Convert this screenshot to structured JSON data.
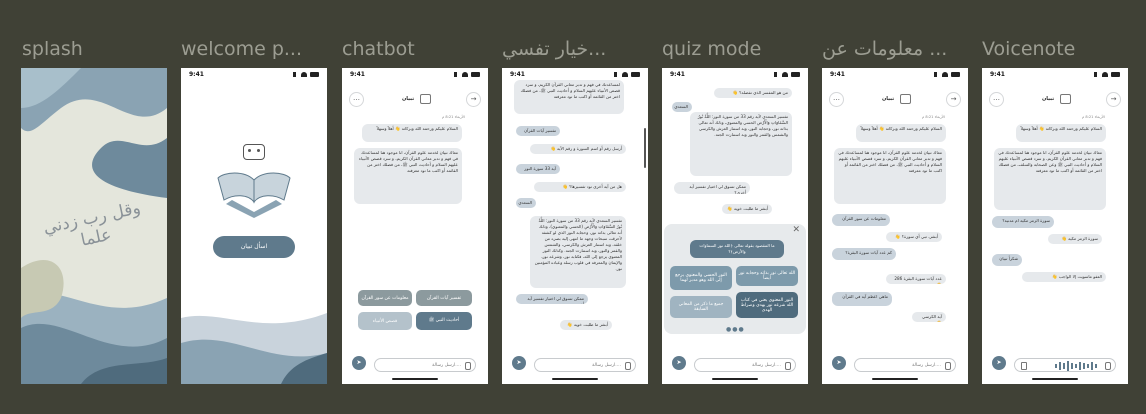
{
  "screens": {
    "splash": {
      "label": "splash",
      "calligraphy": "وقل رب زدني علما"
    },
    "welcome": {
      "label": "welcome p...",
      "time": "9:41",
      "cta_label": "اسأل تبيان"
    },
    "chatbot": {
      "label": "chatbot",
      "time": "9:41",
      "bot_name": "تبيان",
      "timestamp": "الأربعاء 8:21 م",
      "greeting": "السلام عليكم ورحمة الله وبركاته 👋 أهلاً وسهلاً",
      "intro": "معاك تبيان لخدمة علوم القرآن، انا موجود هنا لمساعدتك في فهم و تدبر معاني القرآن الكريم، و سرد قصص الأنبياء عليهم السلام و أحاديث النبي ﷺ، من فضلك اختر من القائمة أو اكتب ما تود معرفته",
      "chips": [
        "تفسير آيات القرآن",
        "معلومات عن سور القرآن",
        "أحاديث النبي ﷺ",
        "قصص الأنبياء"
      ],
      "input_placeholder": "ارسل رسالة...."
    },
    "tafsir": {
      "label": "خيار تفسي...",
      "time": "9:41",
      "top_text": "لمساعدتك في فهم و تدبر معاني القرآن الكريم، و سرد قصص الأنبياء عليهم السلام و أحاديث النبي ﷺ، من فضلك اختر من القائمة أو اكتب ما تود معرفته",
      "u_tafsir": "تفسير آيات القرآن",
      "bot_ask_surah": "أرسل رقم أو اسم السورة و رقم الآية 👋",
      "u_verse": "آية 33 سورة النور",
      "bot_other": "هل من آية أخرى تود تفسيرها؟ 👋",
      "u_no": "السعدي",
      "long_answer": "تفسير السعدي لآية رقم 33 من سورة النور: اللَّهُ نُورُ السَّمَاوَاتِ وَالْأَرْضِ (الحسي والمعنوي)، وذلك أنه تعالى بذاته نور، وحجابه النور الذي لو كشفه لأحرقت سبحات وجهه ما انتهى إليه بصره من خلقه، وبه استنار العرش والكرسي، والشمس والقمر والنور، وبه استنارت الجنة. وكذلك النور المعنوي يرجع إلى الله، فكتابه نور، وشرعه نور، والإيمان والمعرفة في قلوب رسله وعباده المؤمنين نور.",
      "bot_more": "ممكن تسوق لي اختيار تفسير آية أخرى؟",
      "u_thanks": "ممكن تسوق لي اختيار تفسير آية أخرى",
      "bot_help": "أبشر ما طلبت خويه 👋",
      "input_placeholder": "ارسل رسالة...."
    },
    "quiz": {
      "label": "quiz mode",
      "time": "9:41",
      "q1": "من هو المفسر الذي تفضله؟ 👋",
      "a1": "السعدي",
      "long_answer": "تفسير السعدي لآية رقم 33 من سورة النور: اللَّهُ نُورُ السَّمَاوَاتِ وَالْأَرْضِ الحسي والمعنوي، وذلك أنه تعالى بذاته نور، وحجابه النور، وبه استنار العرش والكرسي والشمس والقمر والنور وبه استنارت الجنة.",
      "bot_more": "ممكن تسوق لي اختيار تفسير آية أخرى؟",
      "bot_help": "أبشر ما طلبت خويه 👋",
      "question": "ما المقصود بقوله تعالى ﴿الله نور السماوات والأرض﴾؟",
      "options": [
        "الله تعالى نور بذاته وحجابه نور أيضاً",
        "النور الحسي والمعنوي يرجع إلى الله وهو مدبر لهما",
        "النور المعنوي يعني في كتاب الله شرعه نور يهدي وصراط الهدى",
        "جميع ما ذكر من المعاني السابقة"
      ],
      "input_placeholder": "ارسل رسالة...."
    },
    "info": {
      "label": "معلومات عن ...",
      "time": "9:41",
      "bot_name": "تبيان",
      "timestamp": "الأربعاء 8:21 م",
      "greeting": "السلام عليكم ورحمة الله وبركاته 👋 أهلاً وسهلاً",
      "intro": "معاك تبيان لخدمة علوم القرآن، انا موجود هنا لمساعدتك في فهم و تدبر معاني القرآن الكريم، و سرد قصص الأنبياء عليهم السلام و أحاديث النبي ﷺ، من فضلك اختر من القائمة أو اكتب ما تود معرفته",
      "u1": "معلومات عن سور القرآن",
      "b1": "أبشر، تبي أي سورة؟ 👋",
      "u2": "كم عدد آيات سورة البقرة؟",
      "b2": "عدد آيات سورة البقرة 286 👋",
      "u3": "ماهي اعظم آية في القرآن",
      "b3": "آية الكرسي 👋",
      "input_placeholder": "ارسل رسالة...."
    },
    "voice": {
      "label": "Voicenote",
      "time": "9:41",
      "bot_name": "تبيان",
      "timestamp": "الأربعاء 8:21 م",
      "greeting": "السلام عليكم ورحمة الله وبركاته 👋 أهلاً وسهلاً",
      "intro": "معاك تبيان لخدمة علوم القرآن، انا موجود هنا لمساعدتك في فهم و تدبر معاني القرآن الكريم، و سرد قصص الأنبياء عليهم السلام و أحاديث النبي ﷺ وعن الصحابة والسلف، من فضلك اختر من القائمة أو اكتب ما تود معرفته",
      "u1": "سورة الزمر مكية ام مدنية؟",
      "b1": "سورة الزمر مكية 👋",
      "u2": "شكراً تبيان",
      "b2": "العفو ماسويت إلا الواجب 👋"
    }
  },
  "colors": {
    "bg": "#404136",
    "label": "#9c9d92",
    "accent": "#5f7a8c",
    "bubble": "#e6e9ec",
    "user_bubble": "#c9d3dc"
  }
}
